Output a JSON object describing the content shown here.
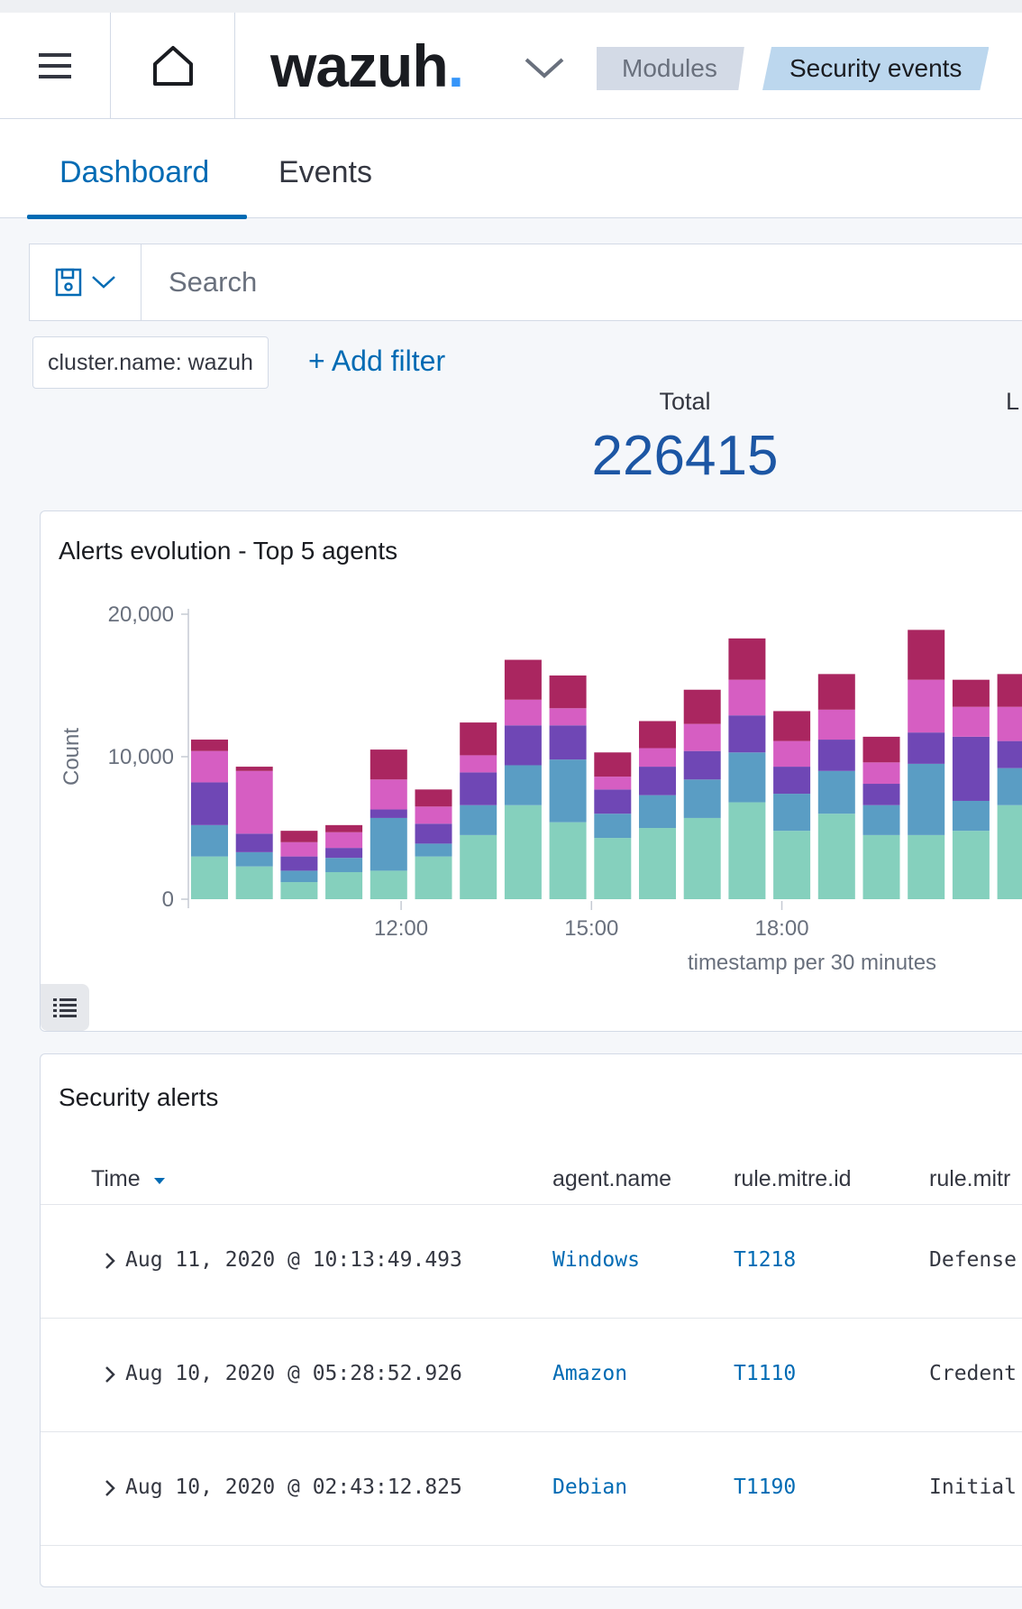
{
  "header": {
    "logo_text": "wazuh",
    "logo_dot": ".",
    "breadcrumbs": [
      "Modules",
      "Security events"
    ]
  },
  "tabs": [
    {
      "label": "Dashboard",
      "active": true
    },
    {
      "label": "Events",
      "active": false
    }
  ],
  "search": {
    "placeholder": "Search"
  },
  "filters": {
    "pill": "cluster.name: wazuh",
    "add_label": "+ Add filter"
  },
  "metrics": {
    "total_label": "Total",
    "total_value": "226415",
    "second_label_partial": "L"
  },
  "chart_panel": {
    "title": "Alerts evolution - Top 5 agents"
  },
  "chart_data": {
    "type": "bar",
    "stacked": true,
    "title": "Alerts evolution - Top 5 agents",
    "xlabel": "timestamp per 30 minutes",
    "ylabel": "Count",
    "ylim": [
      0,
      20000
    ],
    "yticks": [
      "0",
      "10,000",
      "20,000"
    ],
    "xticks": [
      "12:00",
      "15:00",
      "18:00"
    ],
    "series_colors": [
      "#85d0bd",
      "#5a9dc4",
      "#6f47b5",
      "#d65ec2",
      "#aa2660"
    ],
    "series": [
      {
        "values": [
          3000,
          2300,
          1200,
          1900,
          2000,
          3000,
          4500,
          6600,
          5400,
          4300,
          5000,
          5700,
          6800,
          4800,
          6000,
          4500,
          4500,
          4800,
          6600
        ]
      },
      {
        "values": [
          2200,
          1000,
          800,
          1000,
          3700,
          900,
          2100,
          2800,
          4400,
          1700,
          2300,
          2700,
          3500,
          2600,
          3000,
          2100,
          5000,
          2100,
          2600
        ]
      },
      {
        "values": [
          3000,
          1300,
          1000,
          700,
          600,
          1400,
          2300,
          2800,
          2400,
          1700,
          2000,
          2000,
          2600,
          1900,
          2200,
          1500,
          2200,
          4500,
          1900
        ]
      },
      {
        "values": [
          2200,
          4400,
          1000,
          1100,
          2100,
          1200,
          1200,
          1800,
          1200,
          900,
          1300,
          1900,
          2500,
          1800,
          2100,
          1500,
          3700,
          2100,
          2400
        ]
      },
      {
        "values": [
          800,
          300,
          800,
          500,
          2100,
          1200,
          2300,
          2800,
          2300,
          1700,
          1900,
          2400,
          2900,
          2100,
          2500,
          1800,
          3500,
          1900,
          2300
        ]
      }
    ],
    "grid": false,
    "legend": "none"
  },
  "table_panel": {
    "title": "Security alerts",
    "columns": [
      "Time",
      "agent.name",
      "rule.mitre.id",
      "rule.mitr"
    ],
    "rows": [
      {
        "time": "Aug 11, 2020 @ 10:13:49.493",
        "agent": "Windows",
        "mitre_id": "T1218",
        "tactic": "Defense"
      },
      {
        "time": "Aug 10, 2020 @ 05:28:52.926",
        "agent": "Amazon",
        "mitre_id": "T1110",
        "tactic": "Credent"
      },
      {
        "time": "Aug 10, 2020 @ 02:43:12.825",
        "agent": "Debian",
        "mitre_id": "T1190",
        "tactic": "Initial"
      }
    ]
  },
  "icons": {
    "menu": "hamburger-icon",
    "home": "home-icon",
    "save": "save-icon",
    "legend": "list-icon",
    "sort": "sort-down-icon",
    "expand": "chevron-right-icon"
  },
  "colors": {
    "accent": "#006bb4",
    "metric": "#1c56a4",
    "logo_dot": "#3595f9"
  }
}
